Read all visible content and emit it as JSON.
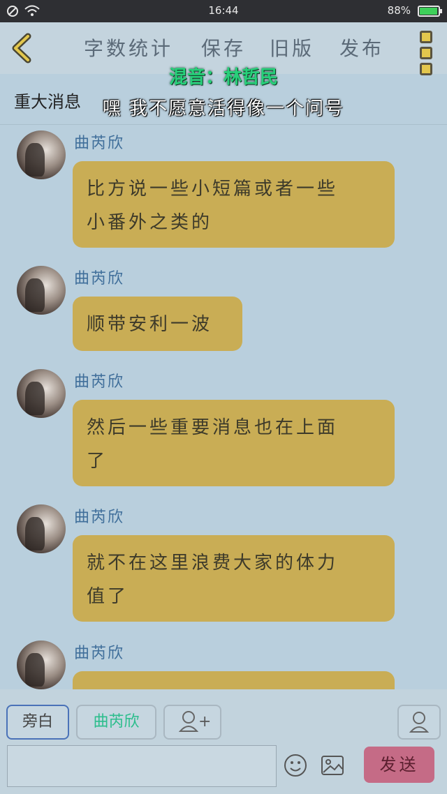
{
  "status_bar": {
    "time": "16:44",
    "battery": "88%"
  },
  "toolbar": {
    "word_count": "字数统计",
    "save": "保存",
    "old_version": "旧版",
    "publish": "发布"
  },
  "overlay": {
    "caption_voice": "混音：林哲民",
    "caption_line": "嘿 我不愿意活得像一个问号"
  },
  "page": {
    "title": "重大消息"
  },
  "messages": [
    {
      "sender": "曲芮欣",
      "line1": "比方说一些小短篇或者一些",
      "line2": "小番外之类的"
    },
    {
      "sender": "曲芮欣",
      "line1": "顺带安利一波"
    },
    {
      "sender": "曲芮欣",
      "line1": "然后一些重要消息也在上面",
      "line2": "了"
    },
    {
      "sender": "曲芮欣",
      "line1": "就不在这里浪费大家的体力",
      "line2": "值了"
    },
    {
      "sender": "曲芮欣",
      "line1": ""
    }
  ],
  "bottom": {
    "chip_narration": "旁白",
    "chip_character": "曲芮欣",
    "add_role_plus": "+",
    "input_value": "",
    "send": "发送"
  },
  "colors": {
    "bubble": "#c9ad55",
    "send": "#c56b86",
    "caption": "#27d07a"
  }
}
